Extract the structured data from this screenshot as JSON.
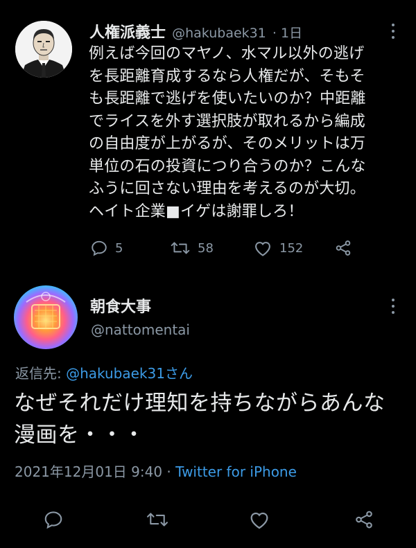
{
  "tweet1": {
    "display_name": "人権派義士",
    "handle": "@hakubaek31",
    "time": "· 1日",
    "text": "例えば今回のマヤノ、水マル以外の逃げ\nを長距離育成するなら人権だが、そもそ\nも長距離で逃げを使いたいのか？中距離\nでライスを外す選択肢が取れるから編成\nの自由度が上がるが、そのメリットは万\n単位の石の投資につり合うのか？こんな\nふうに回さない理由を考えるのが大切。\nヘイト企業■イゲは謝罪しろ！",
    "replies": "5",
    "retweets": "58",
    "likes": "152"
  },
  "tweet2": {
    "display_name": "朝食大事",
    "handle": "@nattomentai",
    "reply_prefix": "返信先: ",
    "reply_target": "@hakubaek31さん",
    "text": "なぜそれだけ理知を持ちながらあんな漫画を・・・",
    "timestamp": "2021年12月01日 9:40",
    "separator": " · ",
    "source": "Twitter for iPhone"
  },
  "colors": {
    "background": "#000000",
    "text": "#e7e9ea",
    "secondary": "#8b98a5",
    "link": "#3c9be6"
  },
  "icons": [
    "reply-icon",
    "retweet-icon",
    "like-icon",
    "share-icon",
    "more-icon"
  ]
}
